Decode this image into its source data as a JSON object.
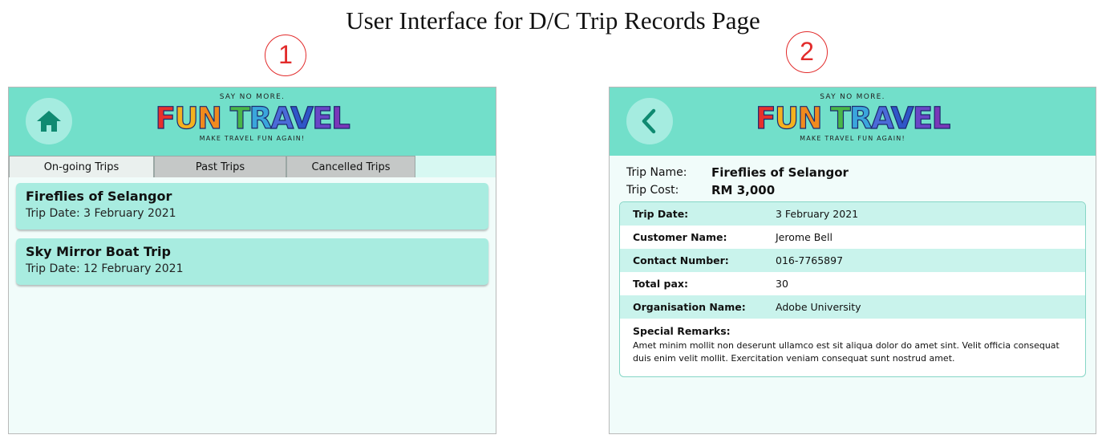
{
  "page": {
    "title": "User Interface for D/C Trip Records Page"
  },
  "markers": [
    "1",
    "2"
  ],
  "colors": {
    "header": "#72dfca",
    "card": "#a8ece0",
    "background": "#f1fcfa",
    "marker": "#e22b2b"
  },
  "logo": {
    "tagline_top": "SAY NO MORE.",
    "word1": "FUN",
    "word2": "TRAVEL",
    "tagline_bottom": "MAKE TRAVEL FUN AGAIN!"
  },
  "screen1": {
    "home_icon": "home-icon",
    "tabs": [
      {
        "label": "On-going Trips",
        "active": true
      },
      {
        "label": "Past Trips",
        "active": false
      },
      {
        "label": "Cancelled Trips",
        "active": false
      }
    ],
    "trips": [
      {
        "name": "Fireflies of Selangor",
        "date": "Trip Date: 3 February 2021"
      },
      {
        "name": "Sky Mirror Boat Trip",
        "date": "Trip Date: 12 February 2021"
      }
    ]
  },
  "screen2": {
    "back_icon": "chevron-left-icon",
    "trip_name_label": "Trip Name:",
    "trip_name": "Fireflies of Selangor",
    "trip_cost_label": "Trip Cost:",
    "trip_cost": "RM 3,000",
    "details": [
      {
        "label": "Trip Date:",
        "value": "3 February 2021"
      },
      {
        "label": "Customer Name:",
        "value": "Jerome Bell"
      },
      {
        "label": "Contact Number:",
        "value": "016-7765897"
      },
      {
        "label": "Total pax:",
        "value": "30"
      },
      {
        "label": "Organisation Name:",
        "value": "Adobe University"
      }
    ],
    "remarks_label": "Special Remarks:",
    "remarks_text": "Amet minim mollit non deserunt ullamco est sit aliqua dolor do amet sint. Velit officia consequat duis enim velit mollit. Exercitation veniam consequat sunt nostrud amet."
  }
}
